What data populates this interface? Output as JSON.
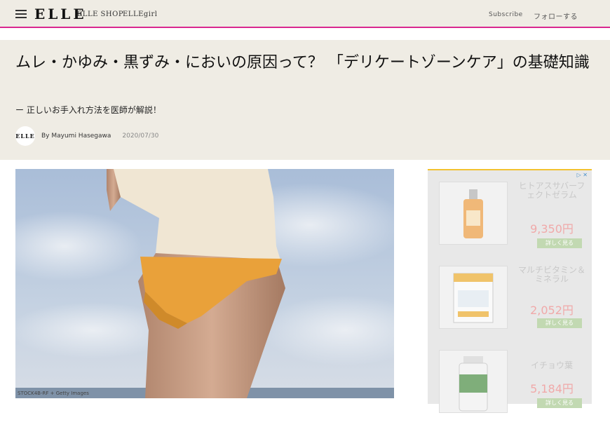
{
  "nav": {
    "logo": "ELLE",
    "links": [
      "ELLE SHOP",
      "ELLEgirl"
    ],
    "subscribe": "Subscribe",
    "follow": "フォローする"
  },
  "article": {
    "title": "ムレ・かゆみ・黒ずみ・においの原因って？ 「デリケートゾーンケア」の基礎知識",
    "subtitle": "ー 正しいお手入れ方法を医師が解説！",
    "avatar_text": "ELLE",
    "byline": "By Mayumi Hasegawa",
    "date": "2020/07/30",
    "image_credit": "STOCK4B-RF + Getty Images"
  },
  "ad": {
    "items": [
      {
        "name": "ヒトアスサバーフェクトゼラム",
        "price": "9,350円",
        "button": "詳しく見る"
      },
      {
        "name": "マルチビタミン＆ミネラル",
        "price": "2,052円",
        "button": "詳しく見る"
      },
      {
        "name": "イチョウ葉",
        "price": "5,184円",
        "button": "詳しく見る"
      }
    ]
  },
  "colors": {
    "accent": "#d9288f",
    "header_bg": "#efece4"
  }
}
